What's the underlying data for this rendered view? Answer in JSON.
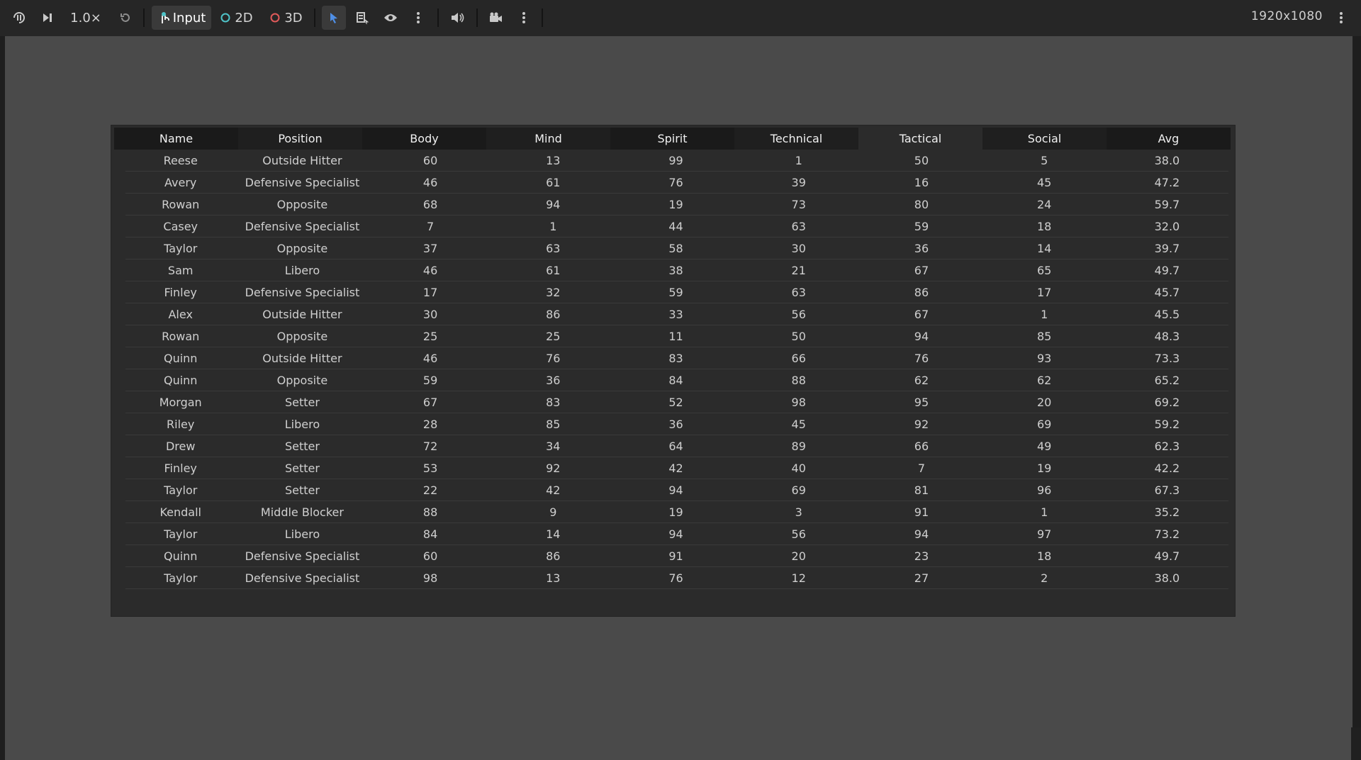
{
  "toolbar": {
    "speed": "1.0×",
    "input_label": "Input",
    "mode_2d": "2D",
    "mode_3d": "3D",
    "resolution": "1920x1080",
    "colors": {
      "accent": "#4f8fe6",
      "mode_2d": "#4fc3c8",
      "mode_3d": "#e05a5a"
    }
  },
  "table": {
    "columns": [
      "Name",
      "Position",
      "Body",
      "Mind",
      "Spirit",
      "Technical",
      "Tactical",
      "Social",
      "Avg"
    ],
    "rows": [
      [
        "Reese",
        "Outside Hitter",
        "60",
        "13",
        "99",
        "1",
        "50",
        "5",
        "38.0"
      ],
      [
        "Avery",
        "Defensive Specialist",
        "46",
        "61",
        "76",
        "39",
        "16",
        "45",
        "47.2"
      ],
      [
        "Rowan",
        "Opposite",
        "68",
        "94",
        "19",
        "73",
        "80",
        "24",
        "59.7"
      ],
      [
        "Casey",
        "Defensive Specialist",
        "7",
        "1",
        "44",
        "63",
        "59",
        "18",
        "32.0"
      ],
      [
        "Taylor",
        "Opposite",
        "37",
        "63",
        "58",
        "30",
        "36",
        "14",
        "39.7"
      ],
      [
        "Sam",
        "Libero",
        "46",
        "61",
        "38",
        "21",
        "67",
        "65",
        "49.7"
      ],
      [
        "Finley",
        "Defensive Specialist",
        "17",
        "32",
        "59",
        "63",
        "86",
        "17",
        "45.7"
      ],
      [
        "Alex",
        "Outside Hitter",
        "30",
        "86",
        "33",
        "56",
        "67",
        "1",
        "45.5"
      ],
      [
        "Rowan",
        "Opposite",
        "25",
        "25",
        "11",
        "50",
        "94",
        "85",
        "48.3"
      ],
      [
        "Quinn",
        "Outside Hitter",
        "46",
        "76",
        "83",
        "66",
        "76",
        "93",
        "73.3"
      ],
      [
        "Quinn",
        "Opposite",
        "59",
        "36",
        "84",
        "88",
        "62",
        "62",
        "65.2"
      ],
      [
        "Morgan",
        "Setter",
        "67",
        "83",
        "52",
        "98",
        "95",
        "20",
        "69.2"
      ],
      [
        "Riley",
        "Libero",
        "28",
        "85",
        "36",
        "45",
        "92",
        "69",
        "59.2"
      ],
      [
        "Drew",
        "Setter",
        "72",
        "34",
        "64",
        "89",
        "66",
        "49",
        "62.3"
      ],
      [
        "Finley",
        "Setter",
        "53",
        "92",
        "42",
        "40",
        "7",
        "19",
        "42.2"
      ],
      [
        "Taylor",
        "Setter",
        "22",
        "42",
        "94",
        "69",
        "81",
        "96",
        "67.3"
      ],
      [
        "Kendall",
        "Middle Blocker",
        "88",
        "9",
        "19",
        "3",
        "91",
        "1",
        "35.2"
      ],
      [
        "Taylor",
        "Libero",
        "84",
        "14",
        "94",
        "56",
        "94",
        "97",
        "73.2"
      ],
      [
        "Quinn",
        "Defensive Specialist",
        "60",
        "86",
        "91",
        "20",
        "23",
        "18",
        "49.7"
      ],
      [
        "Taylor",
        "Defensive Specialist",
        "98",
        "13",
        "76",
        "12",
        "27",
        "2",
        "38.0"
      ]
    ]
  }
}
